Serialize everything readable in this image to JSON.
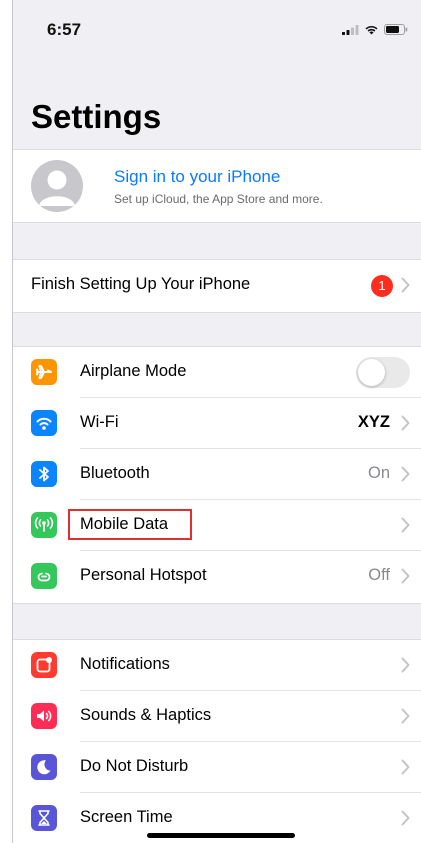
{
  "status_bar": {
    "time": "6:57"
  },
  "header": {
    "title": "Settings"
  },
  "account": {
    "title": "Sign in to your iPhone",
    "subtitle": "Set up iCloud, the App Store and more."
  },
  "finish_setup": {
    "label": "Finish Setting Up Your iPhone",
    "badge": "1"
  },
  "connectivity": {
    "items": [
      {
        "label": "Airplane Mode",
        "icon": "airplane-icon",
        "color": "#ff9500",
        "toggle_on": false
      },
      {
        "label": "Wi-Fi",
        "icon": "wifi-icon",
        "color": "#0a84ff",
        "value": "XYZ"
      },
      {
        "label": "Bluetooth",
        "icon": "bluetooth-icon",
        "color": "#0a84ff",
        "value": "On"
      },
      {
        "label": "Mobile Data",
        "icon": "antenna-icon",
        "color": "#34c759",
        "highlighted": true
      },
      {
        "label": "Personal Hotspot",
        "icon": "hotspot-icon",
        "color": "#34c759",
        "value": "Off"
      }
    ]
  },
  "system": {
    "items": [
      {
        "label": "Notifications",
        "icon": "notifications-icon",
        "color": "#ff3b30"
      },
      {
        "label": "Sounds & Haptics",
        "icon": "speaker-icon",
        "color": "#ff2d55"
      },
      {
        "label": "Do Not Disturb",
        "icon": "moon-icon",
        "color": "#5856d6"
      },
      {
        "label": "Screen Time",
        "icon": "hourglass-icon",
        "color": "#5856d6"
      }
    ]
  },
  "colors": {
    "accent": "#0a7aff",
    "background": "#f0f0f4",
    "badge": "#ff2d20",
    "highlight_border": "#e0302e"
  }
}
